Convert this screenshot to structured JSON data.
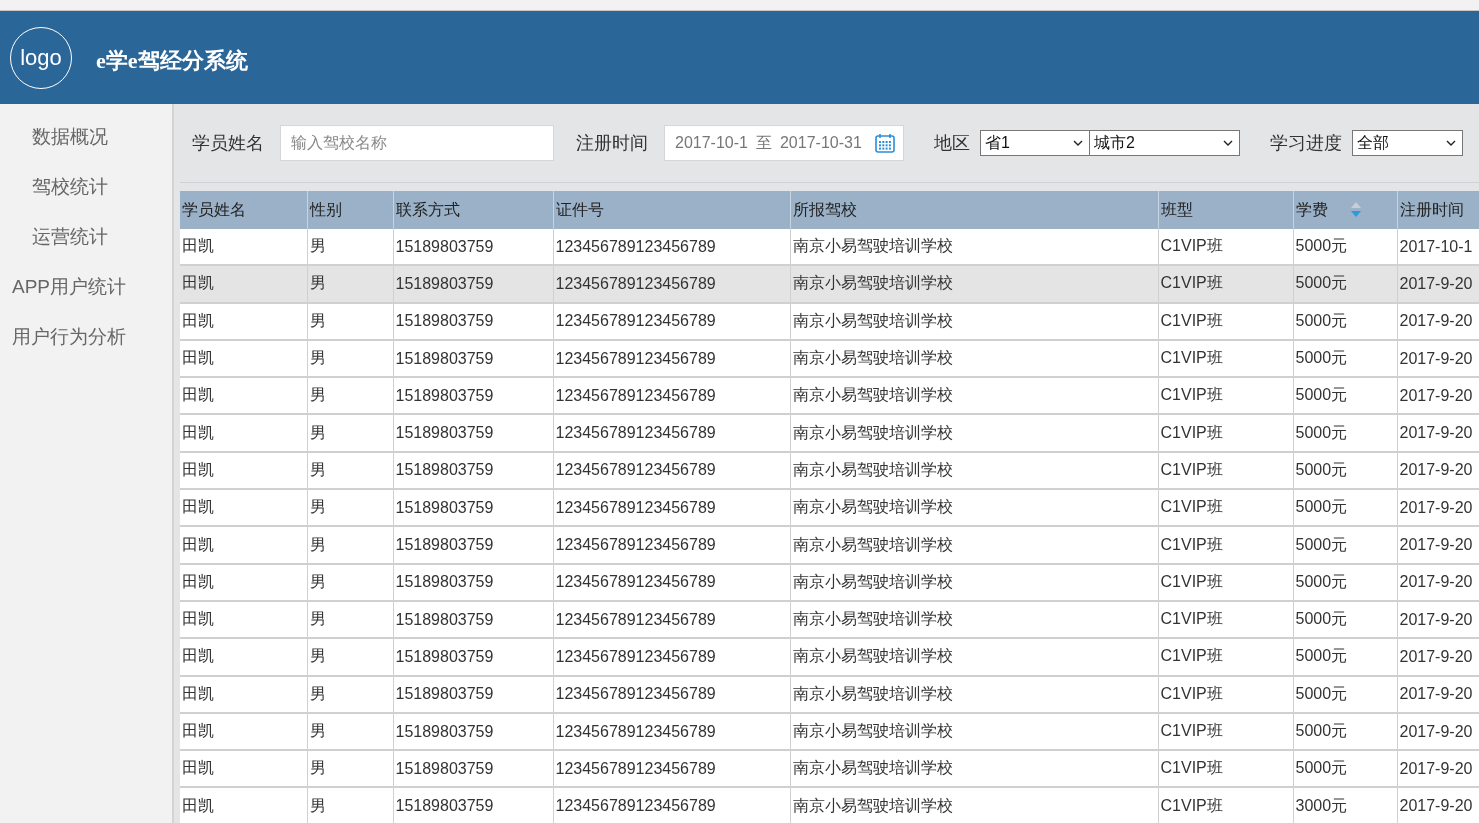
{
  "header": {
    "logo": "logo",
    "title": "e学e驾经分系统"
  },
  "sidebar": {
    "items": [
      {
        "label": "数据概况",
        "indented": true
      },
      {
        "label": "驾校统计",
        "indented": true
      },
      {
        "label": "运营统计",
        "indented": true
      },
      {
        "label": "APP用户统计",
        "indented": false
      },
      {
        "label": "用户行为分析",
        "indented": false
      }
    ]
  },
  "filters": {
    "name_label": "学员姓名",
    "name_placeholder": "输入驾校名称",
    "date_label": "注册时间",
    "date_from": "2017-10-1",
    "date_sep": "至",
    "date_to": "2017-10-31",
    "region_label": "地区",
    "province": "省1",
    "city": "城市2",
    "progress_label": "学习进度",
    "progress": "全部"
  },
  "table": {
    "columns": [
      {
        "label": "学员姓名",
        "sortable": false
      },
      {
        "label": "性别",
        "sortable": false
      },
      {
        "label": "联系方式",
        "sortable": false
      },
      {
        "label": "证件号",
        "sortable": false
      },
      {
        "label": "所报驾校",
        "sortable": false
      },
      {
        "label": "班型",
        "sortable": false
      },
      {
        "label": "学费",
        "sortable": true,
        "descending": true
      },
      {
        "label": "注册时间",
        "sortable": false
      }
    ],
    "rows": [
      {
        "selected": false,
        "cells": [
          "田凯",
          "男",
          "15189803759",
          "123456789123456789",
          "南京小易驾驶培训学校",
          "C1VIP班",
          "5000元",
          "2017-10-1"
        ]
      },
      {
        "selected": true,
        "cells": [
          "田凯",
          "男",
          "15189803759",
          "123456789123456789",
          "南京小易驾驶培训学校",
          "C1VIP班",
          "5000元",
          "2017-9-20"
        ]
      },
      {
        "selected": false,
        "cells": [
          "田凯",
          "男",
          "15189803759",
          "123456789123456789",
          "南京小易驾驶培训学校",
          "C1VIP班",
          "5000元",
          "2017-9-20"
        ]
      },
      {
        "selected": false,
        "cells": [
          "田凯",
          "男",
          "15189803759",
          "123456789123456789",
          "南京小易驾驶培训学校",
          "C1VIP班",
          "5000元",
          "2017-9-20"
        ]
      },
      {
        "selected": false,
        "cells": [
          "田凯",
          "男",
          "15189803759",
          "123456789123456789",
          "南京小易驾驶培训学校",
          "C1VIP班",
          "5000元",
          "2017-9-20"
        ]
      },
      {
        "selected": false,
        "cells": [
          "田凯",
          "男",
          "15189803759",
          "123456789123456789",
          "南京小易驾驶培训学校",
          "C1VIP班",
          "5000元",
          "2017-9-20"
        ]
      },
      {
        "selected": false,
        "cells": [
          "田凯",
          "男",
          "15189803759",
          "123456789123456789",
          "南京小易驾驶培训学校",
          "C1VIP班",
          "5000元",
          "2017-9-20"
        ]
      },
      {
        "selected": false,
        "cells": [
          "田凯",
          "男",
          "15189803759",
          "123456789123456789",
          "南京小易驾驶培训学校",
          "C1VIP班",
          "5000元",
          "2017-9-20"
        ]
      },
      {
        "selected": false,
        "cells": [
          "田凯",
          "男",
          "15189803759",
          "123456789123456789",
          "南京小易驾驶培训学校",
          "C1VIP班",
          "5000元",
          "2017-9-20"
        ]
      },
      {
        "selected": false,
        "cells": [
          "田凯",
          "男",
          "15189803759",
          "123456789123456789",
          "南京小易驾驶培训学校",
          "C1VIP班",
          "5000元",
          "2017-9-20"
        ]
      },
      {
        "selected": false,
        "cells": [
          "田凯",
          "男",
          "15189803759",
          "123456789123456789",
          "南京小易驾驶培训学校",
          "C1VIP班",
          "5000元",
          "2017-9-20"
        ]
      },
      {
        "selected": false,
        "cells": [
          "田凯",
          "男",
          "15189803759",
          "123456789123456789",
          "南京小易驾驶培训学校",
          "C1VIP班",
          "5000元",
          "2017-9-20"
        ]
      },
      {
        "selected": false,
        "cells": [
          "田凯",
          "男",
          "15189803759",
          "123456789123456789",
          "南京小易驾驶培训学校",
          "C1VIP班",
          "5000元",
          "2017-9-20"
        ]
      },
      {
        "selected": false,
        "cells": [
          "田凯",
          "男",
          "15189803759",
          "123456789123456789",
          "南京小易驾驶培训学校",
          "C1VIP班",
          "5000元",
          "2017-9-20"
        ]
      },
      {
        "selected": false,
        "cells": [
          "田凯",
          "男",
          "15189803759",
          "123456789123456789",
          "南京小易驾驶培训学校",
          "C1VIP班",
          "5000元",
          "2017-9-20"
        ]
      },
      {
        "selected": false,
        "cells": [
          "田凯",
          "男",
          "15189803759",
          "123456789123456789",
          "南京小易驾驶培训学校",
          "C1VIP班",
          "3000元",
          "2017-9-20"
        ]
      }
    ]
  }
}
